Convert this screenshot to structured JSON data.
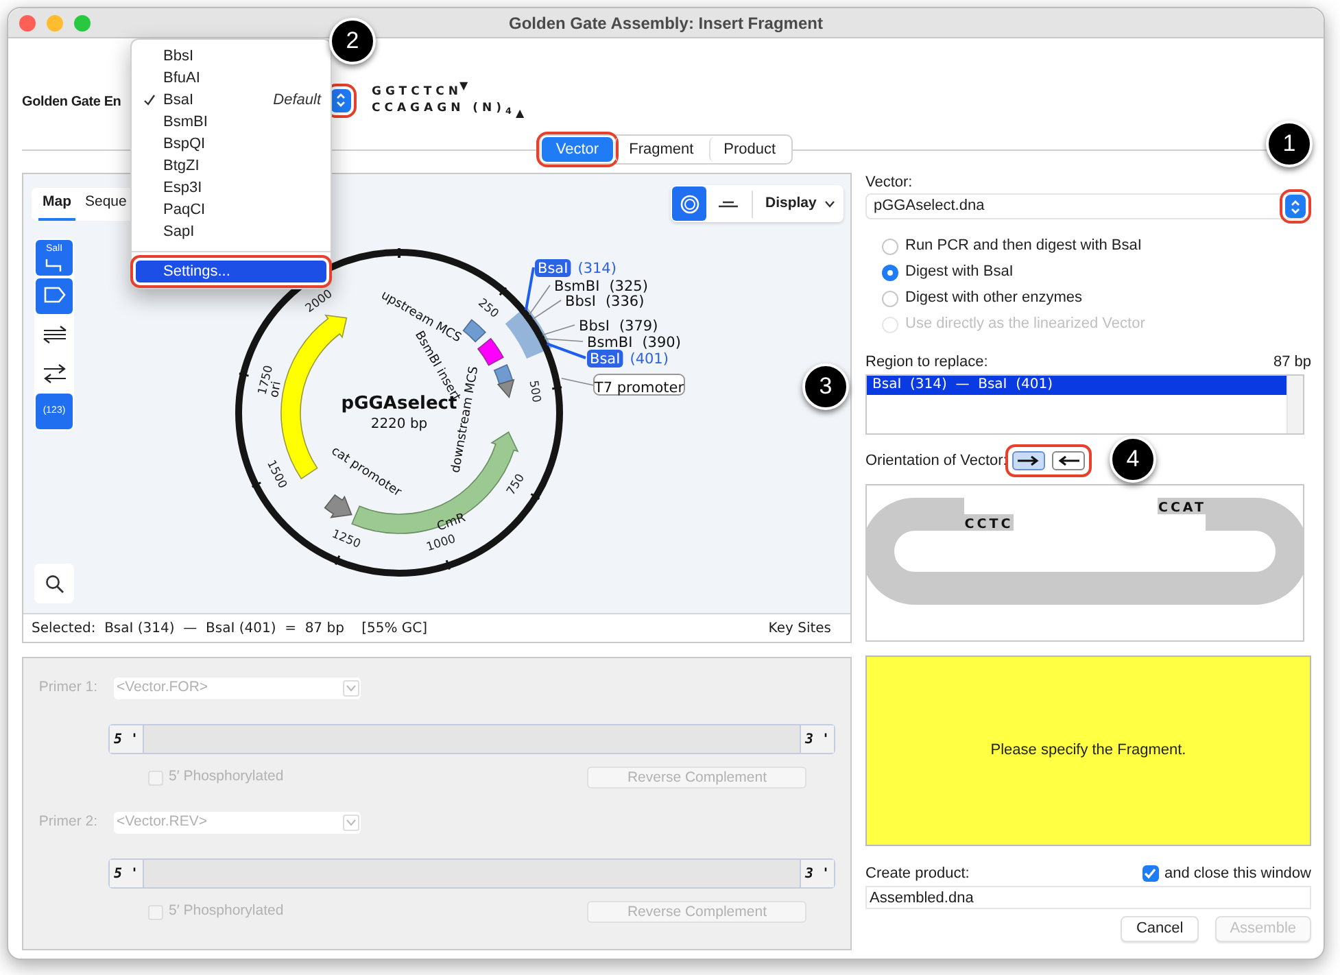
{
  "window": {
    "title": "Golden Gate Assembly: Insert Fragment"
  },
  "enzyme_row": {
    "label": "Golden Gate En",
    "stepper_highlighted": true,
    "site": {
      "top": "GGTCTCN",
      "top_mark": "▼",
      "bottom": "CCAGAGN (N)$_{4}$",
      "bottom_mark": "▲"
    }
  },
  "enzyme_menu": [
    {
      "kind": "enzyme",
      "label": "BbsI",
      "checked": false,
      "selected": false,
      "highlighted": false
    },
    {
      "kind": "enzyme",
      "label": "BfuAI",
      "checked": false,
      "selected": false,
      "highlighted": false
    },
    {
      "kind": "enzyme",
      "label": "BsaI",
      "note": "Default",
      "checked": true,
      "selected": false,
      "highlighted": false
    },
    {
      "kind": "enzyme",
      "label": "BsmBI",
      "checked": false,
      "selected": false,
      "highlighted": false
    },
    {
      "kind": "enzyme",
      "label": "BspQI",
      "checked": false,
      "selected": false,
      "highlighted": false
    },
    {
      "kind": "enzyme",
      "label": "BtgZI",
      "checked": false,
      "selected": false,
      "highlighted": false
    },
    {
      "kind": "enzyme",
      "label": "Esp3I",
      "checked": false,
      "selected": false,
      "highlighted": false
    },
    {
      "kind": "enzyme",
      "label": "PaqCI",
      "checked": false,
      "selected": false,
      "highlighted": false
    },
    {
      "kind": "enzyme",
      "label": "SapI",
      "checked": false,
      "selected": false,
      "highlighted": false
    },
    {
      "kind": "action",
      "label": "Settings...",
      "checked": false,
      "selected": true,
      "highlighted": true
    }
  ],
  "tabs": [
    {
      "label": "Vector",
      "selected": true,
      "highlighted": true
    },
    {
      "label": "Fragment",
      "selected": false,
      "highlighted": false
    },
    {
      "label": "Product",
      "selected": false,
      "highlighted": false
    }
  ],
  "map_panel": {
    "view_tabs": [
      {
        "label": "Map",
        "selected": true
      },
      {
        "label": "Seque",
        "selected": false
      }
    ],
    "tools": [
      {
        "kind": "sites",
        "label": "SalI",
        "on": true
      },
      {
        "kind": "features",
        "on": true
      },
      {
        "kind": "strands",
        "on": false
      },
      {
        "kind": "direction",
        "on": false
      },
      {
        "kind": "numbers",
        "label": "(123)",
        "on": true
      }
    ],
    "view_modes": [
      {
        "kind": "circular",
        "selected": true
      },
      {
        "kind": "linear",
        "selected": false
      }
    ],
    "display_menu": "Display",
    "plasmid": {
      "name": "pGGAselect",
      "length": "2220 bp",
      "ticks": [
        "250",
        "500",
        "750",
        "1000",
        "1250",
        "1500",
        "1750",
        "2000"
      ],
      "features": [
        {
          "kind": "mcs",
          "label": "upstream MCS"
        },
        {
          "kind": "insert",
          "label": "BsmBI insert"
        },
        {
          "kind": "mcs",
          "label": "downstream MCS"
        },
        {
          "kind": "promoter",
          "label": "T7 promoter"
        },
        {
          "kind": "origin",
          "label": "ori"
        },
        {
          "kind": "promoter",
          "label": "cat promoter"
        },
        {
          "kind": "gene",
          "label": "CmR"
        }
      ],
      "sites": [
        {
          "enzyme": "BsaI",
          "position": "(314)",
          "selected": true
        },
        {
          "enzyme": "BsmBI",
          "position": "(325)",
          "selected": false
        },
        {
          "enzyme": "BbsI",
          "position": "(336)",
          "selected": false
        },
        {
          "enzyme": "BbsI",
          "position": "(379)",
          "selected": false
        },
        {
          "enzyme": "BsmBI",
          "position": "(390)",
          "selected": false
        },
        {
          "enzyme": "BsaI",
          "position": "(401)",
          "selected": true
        }
      ]
    },
    "status": "Selected:  BsaI (314)  —  BsaI (401)  =  87 bp    [55% GC]",
    "key_sites": "Key Sites"
  },
  "primers": [
    {
      "label": "Primer 1:",
      "value": "<Vector.FOR>",
      "five_prime": "5 '",
      "three_prime": "3 '",
      "phosphorylated_label": "5′ Phosphorylated",
      "phosphorylated": false,
      "button": "Reverse Complement",
      "disabled": true
    },
    {
      "label": "Primer 2:",
      "value": "<Vector.REV>",
      "five_prime": "5 '",
      "three_prime": "3 '",
      "phosphorylated_label": "5′ Phosphorylated",
      "phosphorylated": false,
      "button": "Reverse Complement",
      "disabled": true
    }
  ],
  "vector": {
    "label": "Vector:",
    "value": "pGGAselect.dna",
    "stepper_highlighted": true,
    "options": [
      {
        "label": "Run PCR and then digest with BsaI",
        "selected": false,
        "disabled": false
      },
      {
        "label": "Digest with BsaI",
        "selected": true,
        "disabled": false
      },
      {
        "label": "Digest with other enzymes",
        "selected": false,
        "disabled": false
      },
      {
        "label": "Use directly as the linearized Vector",
        "selected": false,
        "disabled": true
      }
    ]
  },
  "region": {
    "label": "Region to replace:",
    "length": "87 bp",
    "rows": [
      {
        "text": "BsaI  (314)  —  BsaI  (401)",
        "selected": true
      }
    ]
  },
  "orientation": {
    "label": "Orientation of Vector:",
    "highlighted": true,
    "buttons": [
      {
        "kind": "forward",
        "selected": true
      },
      {
        "kind": "reverse",
        "selected": false
      }
    ]
  },
  "overhangs": {
    "left": "CCTC",
    "right": "CCAT"
  },
  "message": "Please specify the Fragment.",
  "product": {
    "label": "Create product:",
    "close_label": "and close this window",
    "close_checked": true,
    "name": "Assembled.dna"
  },
  "buttons": [
    {
      "label": "Cancel",
      "disabled": false
    },
    {
      "label": "Assemble",
      "disabled": true
    }
  ],
  "callouts": [
    "1",
    "2",
    "3",
    "4"
  ]
}
